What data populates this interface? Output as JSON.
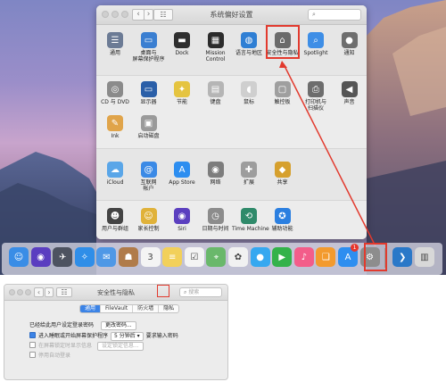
{
  "prefs_window": {
    "title": "系统偏好设置",
    "search_value": "",
    "nav_back": "‹",
    "nav_forward": "›",
    "grid_glyph": "☷",
    "row1": [
      {
        "label": "通用",
        "icon": "general-icon",
        "color": "#6c7b95"
      },
      {
        "label": "桌面与\n屏幕保护程序",
        "icon": "desktop-icon",
        "color": "#3b7fd1"
      },
      {
        "label": "Dock",
        "icon": "dock-icon",
        "color": "#2f2f2f"
      },
      {
        "label": "Mission\nControl",
        "icon": "mission-control-icon",
        "color": "#2c2c2c"
      },
      {
        "label": "语言与地区",
        "icon": "globe-icon",
        "color": "#2f7fd4"
      },
      {
        "label": "安全性与隐私",
        "icon": "house-lock-icon",
        "color": "#6b6b6b"
      },
      {
        "label": "Spotlight",
        "icon": "spotlight-icon",
        "color": "#3e8ee6"
      },
      {
        "label": "通知",
        "icon": "notification-icon",
        "color": "#6e6e6e"
      }
    ],
    "row2": [
      {
        "label": "CD 与 DVD",
        "icon": "cd-icon",
        "color": "#8b8b8b"
      },
      {
        "label": "显示器",
        "icon": "display-icon",
        "color": "#2a5fa8"
      },
      {
        "label": "节能",
        "icon": "bulb-icon",
        "color": "#e5c440"
      },
      {
        "label": "键盘",
        "icon": "keyboard-icon",
        "color": "#b5b5b5"
      },
      {
        "label": "鼠标",
        "icon": "mouse-icon",
        "color": "#cfcfcf"
      },
      {
        "label": "触控板",
        "icon": "trackpad-icon",
        "color": "#9f9f9f"
      },
      {
        "label": "打印机与\n扫描仪",
        "icon": "printer-icon",
        "color": "#6d6d6d"
      },
      {
        "label": "声音",
        "icon": "speaker-icon",
        "color": "#555555"
      }
    ],
    "row2b": [
      {
        "label": "Ink",
        "icon": "ink-icon",
        "color": "#e0a44a"
      },
      {
        "label": "启动磁盘",
        "icon": "disk-icon",
        "color": "#9a9a9a"
      }
    ],
    "row3": [
      {
        "label": "iCloud",
        "icon": "cloud-icon",
        "color": "#5aa6e8"
      },
      {
        "label": "互联网\n帐户",
        "icon": "at-icon",
        "color": "#3b8ae6"
      },
      {
        "label": "App Store",
        "icon": "appstore-icon",
        "color": "#2d8ef0"
      },
      {
        "label": "网络",
        "icon": "network-icon",
        "color": "#7d7d7d"
      },
      {
        "label": "扩展",
        "icon": "puzzle-icon",
        "color": "#9d9d9d"
      },
      {
        "label": "共享",
        "icon": "share-icon",
        "color": "#d6a02e"
      }
    ],
    "row4": [
      {
        "label": "用户与群组",
        "icon": "users-icon",
        "color": "#444444"
      },
      {
        "label": "家长控制",
        "icon": "parental-icon",
        "color": "#e0b23a"
      },
      {
        "label": "Siri",
        "icon": "siri-icon",
        "color": "#5b3fbf"
      },
      {
        "label": "日期与时间",
        "icon": "clock-icon",
        "color": "#8c8c8c"
      },
      {
        "label": "Time Machine",
        "icon": "timemachine-icon",
        "color": "#2f8a6a"
      },
      {
        "label": "辅助功能",
        "icon": "accessibility-icon",
        "color": "#2b7fe0"
      }
    ]
  },
  "dock": {
    "items": [
      {
        "name": "finder-icon",
        "color": "#3a8de6",
        "glyph": "☺"
      },
      {
        "name": "siri-dock-icon",
        "color": "#5a3ec0",
        "glyph": "◉"
      },
      {
        "name": "launchpad-icon",
        "color": "#4d5360",
        "glyph": "✈"
      },
      {
        "name": "safari-icon",
        "color": "#2f8ee8",
        "glyph": "✧"
      },
      {
        "name": "mail-icon",
        "color": "#4f98e6",
        "glyph": "✉"
      },
      {
        "name": "contacts-icon",
        "color": "#b07b4a",
        "glyph": "☗"
      },
      {
        "name": "calendar-icon",
        "color": "#f4f4f4",
        "glyph": "3"
      },
      {
        "name": "notes-icon",
        "color": "#f2d05a",
        "glyph": "≡"
      },
      {
        "name": "reminders-icon",
        "color": "#f4f4f4",
        "glyph": "☑"
      },
      {
        "name": "maps-icon",
        "color": "#6ab86b",
        "glyph": "⌖"
      },
      {
        "name": "photos-icon",
        "color": "#f1f1f1",
        "glyph": "✿"
      },
      {
        "name": "messages-icon",
        "color": "#36a8f0",
        "glyph": "●"
      },
      {
        "name": "facetime-icon",
        "color": "#33b24a",
        "glyph": "▶"
      },
      {
        "name": "itunes-icon",
        "color": "#f35d8a",
        "glyph": "♪"
      },
      {
        "name": "ibooks-icon",
        "color": "#f39a2e",
        "glyph": "❑"
      },
      {
        "name": "appstore-dock-icon",
        "color": "#2e8ef0",
        "glyph": "A"
      },
      {
        "name": "system-preferences-dock-icon",
        "color": "#8d8d8d",
        "glyph": "⚙"
      },
      {
        "name": "vscode-icon",
        "color": "#2a78c8",
        "glyph": "❯"
      },
      {
        "name": "trash-icon",
        "color": "#d8d8d8",
        "glyph": "▥"
      }
    ],
    "appstore_badge": "1"
  },
  "security_window": {
    "title": "安全性与隐私",
    "search_placeholder": "搜索",
    "nav_back": "‹",
    "nav_forward": "›",
    "grid_glyph": "☷",
    "tabs": [
      "通用",
      "FileVault",
      "防火墙",
      "隐私"
    ],
    "password_label": "已经给此用户设定登录密码",
    "change_password_button": "更改密码...",
    "require_password_label": "进入睡眠或开始屏幕保护程序",
    "require_password_value": "5 分钟后",
    "require_password_suffix": "要求输入密码",
    "show_message_label": "在屏幕锁定时显示信息",
    "set_lock_message_button": "设定锁定信息...",
    "disable_auto_login_label": "停用自动登录"
  }
}
